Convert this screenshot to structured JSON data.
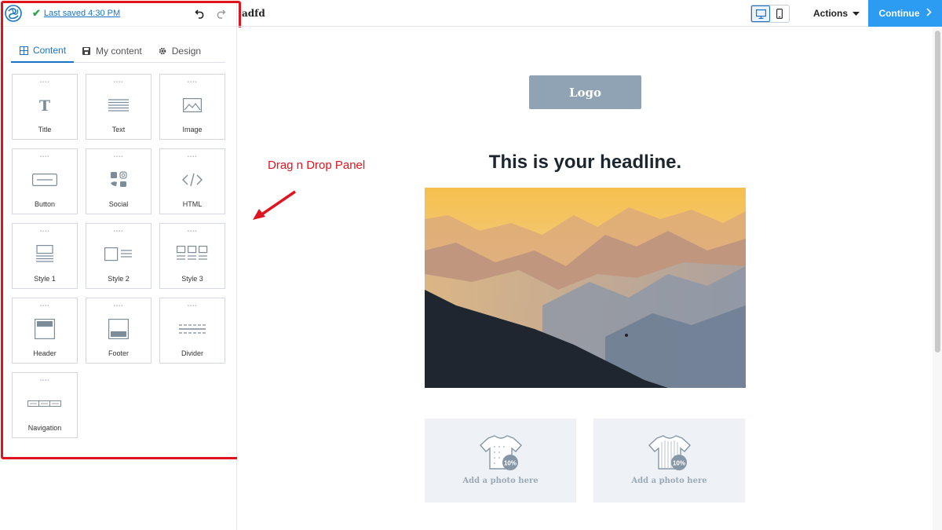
{
  "sidebar": {
    "saved_text": "Last saved 4:30 PM",
    "tabs": [
      {
        "label": "Content",
        "icon": "grid-icon"
      },
      {
        "label": "My content",
        "icon": "save-icon"
      },
      {
        "label": "Design",
        "icon": "gear-icon"
      }
    ],
    "active_tab": "Content",
    "blocks": [
      {
        "label": "Title",
        "icon": "title-icon"
      },
      {
        "label": "Text",
        "icon": "text-icon"
      },
      {
        "label": "Image",
        "icon": "image-icon"
      },
      {
        "label": "Button",
        "icon": "button-icon"
      },
      {
        "label": "Social",
        "icon": "social-icon"
      },
      {
        "label": "HTML",
        "icon": "html-icon"
      },
      {
        "label": "Style 1",
        "icon": "style1-icon"
      },
      {
        "label": "Style 2",
        "icon": "style2-icon"
      },
      {
        "label": "Style 3",
        "icon": "style3-icon"
      },
      {
        "label": "Header",
        "icon": "header-icon"
      },
      {
        "label": "Footer",
        "icon": "footer-icon"
      },
      {
        "label": "Divider",
        "icon": "divider-icon"
      },
      {
        "label": "Navigation",
        "icon": "navigation-icon"
      }
    ]
  },
  "topbar": {
    "doc_title": "adfd",
    "actions_label": "Actions",
    "continue_label": "Continue",
    "active_device": "desktop"
  },
  "canvas": {
    "logo_label": "Logo",
    "headline": "This is your headline.",
    "photo_slots": [
      {
        "label": "Add a photo here",
        "badge": "10%"
      },
      {
        "label": "Add a photo here",
        "badge": "10%"
      }
    ]
  },
  "annotation": {
    "text": "Drag n Drop Panel"
  },
  "colors": {
    "accent": "#1a73c7",
    "continue_bg": "#2c9cf2",
    "annotation_red": "#e0141e",
    "logo_bg": "#8fa3b4"
  }
}
